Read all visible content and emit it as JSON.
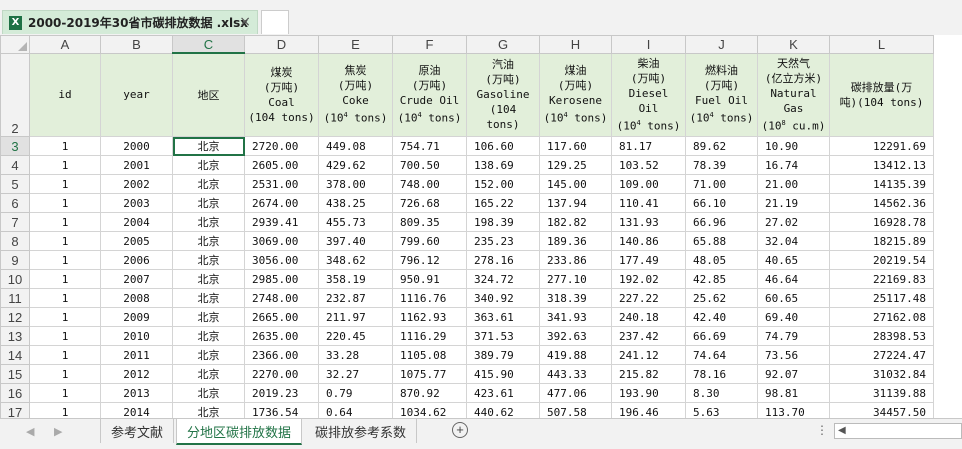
{
  "window": {
    "file_name": "2000-2019年30省市碳排放数据 .xlsx",
    "close_icon": "×"
  },
  "columns": [
    "A",
    "B",
    "C",
    "D",
    "E",
    "F",
    "G",
    "H",
    "I",
    "J",
    "K",
    "L"
  ],
  "header_row_number": "2",
  "header": {
    "id": "id",
    "year": "year",
    "region": "地区",
    "coal": [
      "煤炭",
      "(万吨)",
      "Coal",
      "(104 tons)"
    ],
    "coke": [
      "焦炭",
      "(万吨)",
      "Coke",
      "(10",
      "4",
      " tons)"
    ],
    "crude": [
      "原油",
      "(万吨)",
      "Crude Oil",
      "(10",
      "4",
      " tons)"
    ],
    "gasoline": [
      "汽油",
      "(万吨)",
      "Gasoline",
      "(104",
      "tons)"
    ],
    "kerosene": [
      "煤油",
      "(万吨)",
      "Kerosene",
      "(10",
      "4",
      " tons)"
    ],
    "diesel": [
      "柴油",
      "(万吨)",
      "Diesel",
      "Oil",
      "(10",
      "4",
      " tons)"
    ],
    "fuel": [
      "燃料油",
      "(万吨)",
      "Fuel Oil",
      "(10",
      "4",
      " tons)"
    ],
    "gas": [
      "天然气",
      "(亿立方米)",
      "Natural",
      "Gas",
      "(10",
      "8",
      " cu.m)"
    ],
    "carbon": [
      "碳排放量(万",
      "吨)(104 tons)"
    ]
  },
  "rows": [
    {
      "n": "3",
      "id": "1",
      "year": "2000",
      "region": "北京",
      "coal": "2720.00",
      "coke": "449.08",
      "crude": "754.71",
      "gasoline": "106.60",
      "kerosene": "117.60",
      "diesel": "81.17",
      "fuel": "89.62",
      "gas": "10.90",
      "carbon": "12291.69"
    },
    {
      "n": "4",
      "id": "1",
      "year": "2001",
      "region": "北京",
      "coal": "2605.00",
      "coke": "429.62",
      "crude": "700.50",
      "gasoline": "138.69",
      "kerosene": "129.25",
      "diesel": "103.52",
      "fuel": "78.39",
      "gas": "16.74",
      "carbon": "13412.13"
    },
    {
      "n": "5",
      "id": "1",
      "year": "2002",
      "region": "北京",
      "coal": "2531.00",
      "coke": "378.00",
      "crude": "748.00",
      "gasoline": "152.00",
      "kerosene": "145.00",
      "diesel": "109.00",
      "fuel": "71.00",
      "gas": "21.00",
      "carbon": "14135.39"
    },
    {
      "n": "6",
      "id": "1",
      "year": "2003",
      "region": "北京",
      "coal": "2674.00",
      "coke": "438.25",
      "crude": "726.68",
      "gasoline": "165.22",
      "kerosene": "137.94",
      "diesel": "110.41",
      "fuel": "66.10",
      "gas": "21.19",
      "carbon": "14562.36"
    },
    {
      "n": "7",
      "id": "1",
      "year": "2004",
      "region": "北京",
      "coal": "2939.41",
      "coke": "455.73",
      "crude": "809.35",
      "gasoline": "198.39",
      "kerosene": "182.82",
      "diesel": "131.93",
      "fuel": "66.96",
      "gas": "27.02",
      "carbon": "16928.78"
    },
    {
      "n": "8",
      "id": "1",
      "year": "2005",
      "region": "北京",
      "coal": "3069.00",
      "coke": "397.40",
      "crude": "799.60",
      "gasoline": "235.23",
      "kerosene": "189.36",
      "diesel": "140.86",
      "fuel": "65.88",
      "gas": "32.04",
      "carbon": "18215.89"
    },
    {
      "n": "9",
      "id": "1",
      "year": "2006",
      "region": "北京",
      "coal": "3056.00",
      "coke": "348.62",
      "crude": "796.12",
      "gasoline": "278.16",
      "kerosene": "233.86",
      "diesel": "177.49",
      "fuel": "48.05",
      "gas": "40.65",
      "carbon": "20219.54"
    },
    {
      "n": "10",
      "id": "1",
      "year": "2007",
      "region": "北京",
      "coal": "2985.00",
      "coke": "358.19",
      "crude": "950.91",
      "gasoline": "324.72",
      "kerosene": "277.10",
      "diesel": "192.02",
      "fuel": "42.85",
      "gas": "46.64",
      "carbon": "22169.83"
    },
    {
      "n": "11",
      "id": "1",
      "year": "2008",
      "region": "北京",
      "coal": "2748.00",
      "coke": "232.87",
      "crude": "1116.76",
      "gasoline": "340.92",
      "kerosene": "318.39",
      "diesel": "227.22",
      "fuel": "25.62",
      "gas": "60.65",
      "carbon": "25117.48"
    },
    {
      "n": "12",
      "id": "1",
      "year": "2009",
      "region": "北京",
      "coal": "2665.00",
      "coke": "211.97",
      "crude": "1162.93",
      "gasoline": "363.61",
      "kerosene": "341.93",
      "diesel": "240.18",
      "fuel": "42.40",
      "gas": "69.40",
      "carbon": "27162.08"
    },
    {
      "n": "13",
      "id": "1",
      "year": "2010",
      "region": "北京",
      "coal": "2635.00",
      "coke": "220.45",
      "crude": "1116.29",
      "gasoline": "371.53",
      "kerosene": "392.63",
      "diesel": "237.42",
      "fuel": "66.69",
      "gas": "74.79",
      "carbon": "28398.53"
    },
    {
      "n": "14",
      "id": "1",
      "year": "2011",
      "region": "北京",
      "coal": "2366.00",
      "coke": "33.28",
      "crude": "1105.08",
      "gasoline": "389.79",
      "kerosene": "419.88",
      "diesel": "241.12",
      "fuel": "74.64",
      "gas": "73.56",
      "carbon": "27224.47"
    },
    {
      "n": "15",
      "id": "1",
      "year": "2012",
      "region": "北京",
      "coal": "2270.00",
      "coke": "32.27",
      "crude": "1075.77",
      "gasoline": "415.90",
      "kerosene": "443.33",
      "diesel": "215.82",
      "fuel": "78.16",
      "gas": "92.07",
      "carbon": "31032.84"
    },
    {
      "n": "16",
      "id": "1",
      "year": "2013",
      "region": "北京",
      "coal": "2019.23",
      "coke": "0.79",
      "crude": "870.92",
      "gasoline": "423.61",
      "kerosene": "477.06",
      "diesel": "193.90",
      "fuel": "8.30",
      "gas": "98.81",
      "carbon": "31139.88"
    },
    {
      "n": "17",
      "id": "1",
      "year": "2014",
      "region": "北京",
      "coal": "1736.54",
      "coke": "0.64",
      "crude": "1034.62",
      "gasoline": "440.62",
      "kerosene": "507.58",
      "diesel": "196.46",
      "fuel": "5.63",
      "gas": "113.70",
      "carbon": "34457.50"
    }
  ],
  "sheets": [
    "参考文献",
    "分地区碳排放数据",
    "碳排放参考系数"
  ],
  "add_sheet": "+",
  "more": "⋮"
}
